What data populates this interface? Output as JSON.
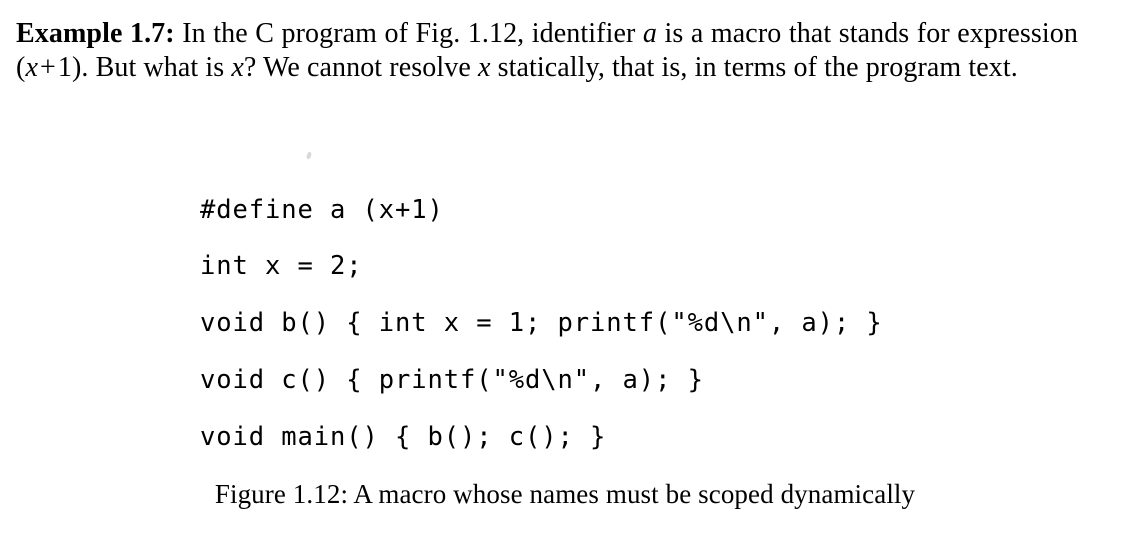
{
  "page": {
    "background_color": "#ffffff",
    "text_color": "#000000"
  },
  "example": {
    "label": "Example 1.7:",
    "text_part_1": " In the C program of Fig. 1.12, identifier ",
    "identifier_a": "a",
    "text_part_2": " is a macro that stands for expression ",
    "expression_open": "(",
    "expression_var": "x",
    "expression_op": "+",
    "expression_value": "1",
    "expression_close": ")",
    "text_part_3": ". But what is ",
    "question_var": "x",
    "text_part_4": "? We cannot resolve ",
    "static_var": "x",
    "text_part_5": " statically, that is, in terms of the program text."
  },
  "code_listing": {
    "language": "c",
    "lines": [
      "#define a (x+1)",
      "int x = 2;",
      "void b() { int x = 1; printf(\"%d\\n\", a); }",
      "void c() { printf(\"%d\\n\", a); }",
      "void main() { b(); c(); }"
    ]
  },
  "figure": {
    "caption": "Figure 1.12: A macro whose names must be scoped dynamically",
    "number": "1.12"
  }
}
